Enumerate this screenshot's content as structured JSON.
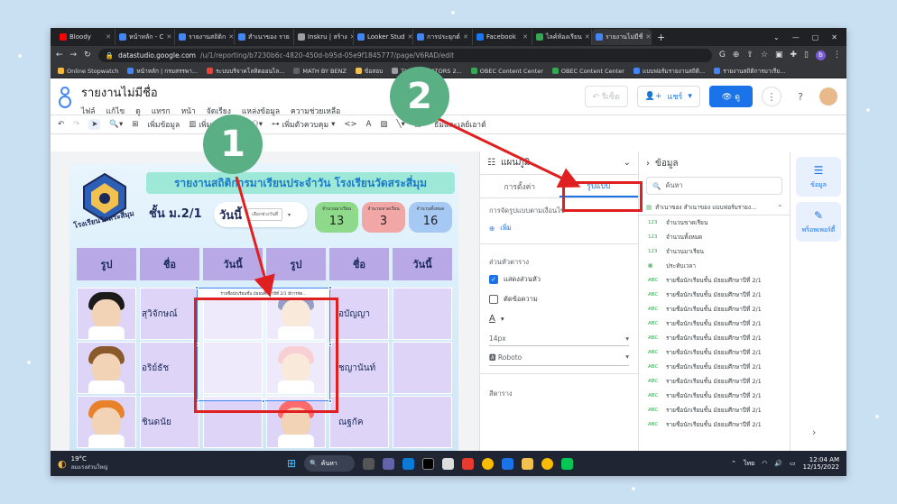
{
  "browser": {
    "tabs": [
      {
        "label": "Bloody",
        "color": "#ff0000"
      },
      {
        "label": "หน้าหลัก - C",
        "color": "#4285f4"
      },
      {
        "label": "รายงานสถิติก",
        "color": "#4285f4"
      },
      {
        "label": "สำเนาของ ราย",
        "color": "#4285f4"
      },
      {
        "label": "Inskru | สร้าง",
        "color": "#9aa0a6"
      },
      {
        "label": "Looker Stud",
        "color": "#4285f4"
      },
      {
        "label": "การประยุกต์",
        "color": "#4285f4"
      },
      {
        "label": "Facebook",
        "color": "#1877f2"
      },
      {
        "label": "ไลค์ห้องเรียน",
        "color": "#34a853"
      },
      {
        "label": "รายงานไม่มีชื่",
        "color": "#4285f4"
      }
    ],
    "url_host": "datastudio.google.com",
    "url_path": "/u/1/reporting/b7230b6c-4820-450d-b95d-05e9f1845777/page/V6RAD/edit",
    "bookmarks": [
      "Online Stopwatch",
      "หน้าหลัก | กรมสรรพา...",
      "ระบบบริจาคโลหิตออนไล...",
      "MATH BY BENZ",
      "ข้อสอบ",
      "THE EDUCATORS 2...",
      "OBEC Content Center",
      "OBEC Content Center",
      "แบบฟอร์มรายงานสถิติ...",
      "รายงานสถิติการมาเรีย..."
    ],
    "profile_letter": "b"
  },
  "app": {
    "title": "รายงานไม่มีชื่อ",
    "menu": [
      "ไฟล์",
      "แก้ไข",
      "ดู",
      "แทรก",
      "หน้า",
      "จัดเรียง",
      "แหล่งข้อมูล",
      "ความช่วยเหลือ"
    ],
    "reset": "รีเซ็ต",
    "share": "แชร์",
    "view": "ดู",
    "toolbar": {
      "add_data": "เพิ่มข้อมูล",
      "add_chart": "เพิ่มแผนภูมิ",
      "add_control": "เพิ่มตัวควบคุม",
      "theme_layout": "ธีมและเลย์เอาต์"
    }
  },
  "report": {
    "title": "รายงานสถิติการมาเรียนประจำวัน โรงเรียนวัดสระสี่มุม",
    "school_name": "โรงเรียนวัดสระสี่มุม",
    "class": "ชั้น ม.2/1",
    "today_label": "วันนี้",
    "date_select": "เลือกช่วงวันที่",
    "stats": [
      {
        "label": "จำนวนมาเรียน",
        "value": "13",
        "color": "#8fd98a"
      },
      {
        "label": "จำนวนขาดเรียน",
        "value": "3",
        "color": "#f2a7a7"
      },
      {
        "label": "จำนวนทั้งหมด",
        "value": "16",
        "color": "#a5c9f2"
      }
    ],
    "headers": [
      "รูป",
      "ชื่อ",
      "วันนี้",
      "รูป",
      "ชื่อ",
      "วันนี้"
    ],
    "students_left": [
      "สุวิจักษณ์",
      "อริย์ธัช",
      "ชินดนัย"
    ],
    "students_right": [
      "อบัญญา",
      "ชญานันท์",
      "ณฐกัค"
    ],
    "embedded_table_title": "รายชื่อนักเรียนชั้น มัธยมศึกษาปีที่ 2/1 มีการจัด..."
  },
  "properties": {
    "chart_type": "แผนภูมิ",
    "tab_setup": "การตั้งค่า",
    "tab_style": "รูปแบบ",
    "conditional": "การจัดรูปแบบตามเงื่อนไข",
    "add": "เพิ่ม",
    "table_header": "ส่วนหัวตาราง",
    "show_header": "แสดงส่วนหัว",
    "wrap_text": "ตัดข้อความ",
    "font_size": "14px",
    "font_family": "Roboto",
    "table_colors": "สีตาราง"
  },
  "datapanel": {
    "title": "ข้อมูล",
    "search_placeholder": "ค้นหา",
    "source": "สำเนาของ สำเนาของ แบบฟอร์มรายง...",
    "fields": [
      {
        "type": "123",
        "name": "จำนวนขาดเรียน"
      },
      {
        "type": "123",
        "name": "จำนวนทั้งหมด"
      },
      {
        "type": "123",
        "name": "จำนวนมาเรียน"
      },
      {
        "type": "date",
        "name": "ประทับเวลา"
      },
      {
        "type": "ABC",
        "name": "รายชื่อนักเรียนชั้น มัธยมศึกษาปีที่ 2/1"
      },
      {
        "type": "ABC",
        "name": "รายชื่อนักเรียนชั้น มัธยมศึกษาปีที่ 2/1"
      },
      {
        "type": "ABC",
        "name": "รายชื่อนักเรียนชั้น มัธยมศึกษาปีที่ 2/1"
      },
      {
        "type": "ABC",
        "name": "รายชื่อนักเรียนชั้น มัธยมศึกษาปีที่ 2/1"
      },
      {
        "type": "ABC",
        "name": "รายชื่อนักเรียนชั้น มัธยมศึกษาปีที่ 2/1"
      },
      {
        "type": "ABC",
        "name": "รายชื่อนักเรียนชั้น มัธยมศึกษาปีที่ 2/1"
      },
      {
        "type": "ABC",
        "name": "รายชื่อนักเรียนชั้น มัธยมศึกษาปีที่ 2/1"
      },
      {
        "type": "ABC",
        "name": "รายชื่อนักเรียนชั้น มัธยมศึกษาปีที่ 2/1"
      },
      {
        "type": "ABC",
        "name": "รายชื่อนักเรียนชั้น มัธยมศึกษาปีที่ 2/1"
      },
      {
        "type": "ABC",
        "name": "รายชื่อนักเรียนชั้น มัธยมศึกษาปีที่ 2/1"
      },
      {
        "type": "ABC",
        "name": "รายชื่อนักเรียนชั้น มัธยมศึกษาปีที่ 2/1"
      }
    ]
  },
  "rail": {
    "data": "ข้อมูล",
    "properties": "พร็อพเพอร์ตี้"
  },
  "taskbar": {
    "temp": "19°C",
    "weather": "ลมแรงส่วนใหญ่",
    "search": "ค้นหา",
    "lang": "ไทย",
    "time": "12:04 AM",
    "date": "12/15/2022"
  },
  "annotations": {
    "step1": "1",
    "step2": "2"
  }
}
